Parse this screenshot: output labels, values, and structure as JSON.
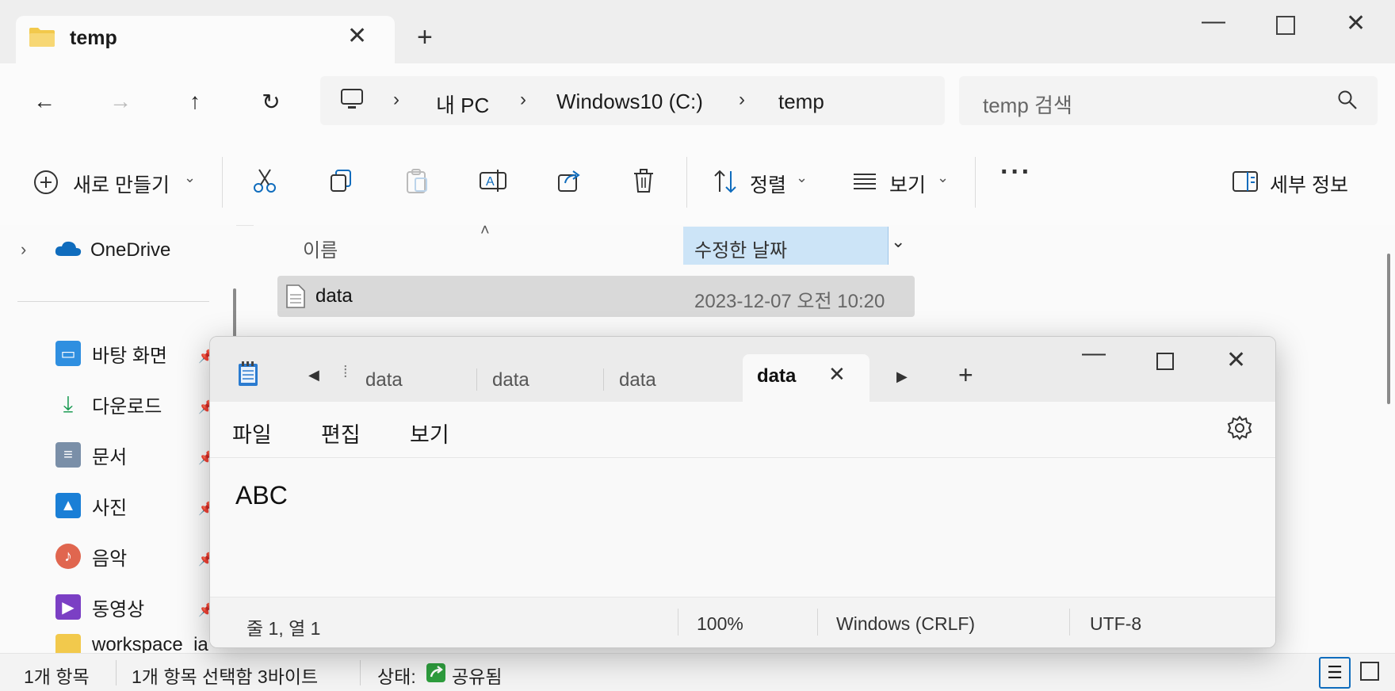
{
  "explorer": {
    "tab_title": "temp",
    "breadcrumb": [
      "내 PC",
      "Windows10 (C:)",
      "temp"
    ],
    "search_placeholder": "temp 검색",
    "commands": {
      "new": "새로 만들기",
      "sort": "정렬",
      "view": "보기",
      "details": "세부 정보"
    },
    "nav": {
      "onedrive": "OneDrive",
      "items": [
        "바탕 화면",
        "다운로드",
        "문서",
        "사진",
        "음악",
        "동영상"
      ],
      "partial": "workspace_ia"
    },
    "columns": {
      "name": "이름",
      "modified": "수정한 날짜"
    },
    "files": [
      {
        "name": "data",
        "modified": "2023-12-07 오전 10:20"
      }
    ],
    "status": {
      "count": "1개 항목",
      "selection": "1개 항목 선택함 3바이트",
      "state_label": "상태:",
      "state_value": "공유됨"
    }
  },
  "notepad": {
    "tabs": [
      "data",
      "data",
      "data",
      "data"
    ],
    "active_tab_index": 3,
    "menu": [
      "파일",
      "편집",
      "보기"
    ],
    "content": "ABC",
    "status": {
      "position": "줄 1, 열 1",
      "zoom": "100%",
      "line_ending": "Windows (CRLF)",
      "encoding": "UTF-8"
    }
  },
  "colors": {
    "folder": "#f2c94c",
    "selected_header": "#cce4f7",
    "selected_row": "#d9d9d9",
    "onedrive": "#0f6cbd",
    "share_green": "#2e9e3e"
  }
}
